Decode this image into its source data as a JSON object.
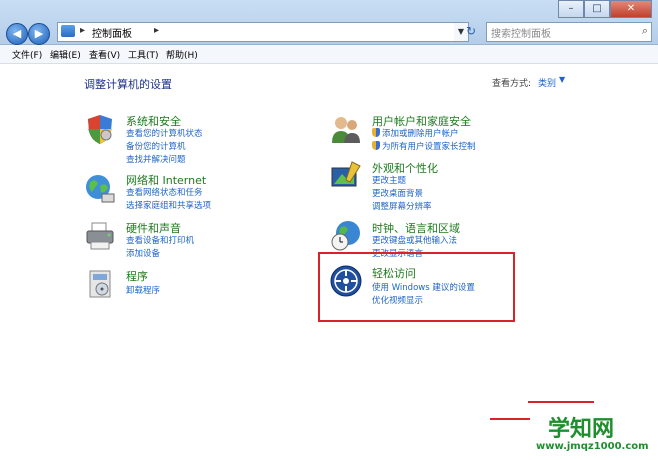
{
  "address": {
    "path": "控制面板",
    "separator": "▸"
  },
  "search": {
    "placeholder": "搜索控制面板"
  },
  "menu": [
    "文件(F)",
    "编辑(E)",
    "查看(V)",
    "工具(T)",
    "帮助(H)"
  ],
  "page_title": "调整计算机的设置",
  "view_by": {
    "label": "查看方式:",
    "value": "类别"
  },
  "categories": [
    {
      "title": "系统和安全",
      "links": [
        "查看您的计算机状态",
        "备份您的计算机",
        "查找并解决问题"
      ]
    },
    {
      "title": "网络和 Internet",
      "links": [
        "查看网络状态和任务",
        "选择家庭组和共享选项"
      ]
    },
    {
      "title": "硬件和声音",
      "links": [
        "查看设备和打印机",
        "添加设备"
      ]
    },
    {
      "title": "程序",
      "links": [
        "卸载程序"
      ]
    },
    {
      "title": "用户帐户和家庭安全",
      "links": [
        "添加或删除用户帐户",
        "为所有用户设置家长控制"
      ]
    },
    {
      "title": "外观和个性化",
      "links": [
        "更改主题",
        "更改桌面背景",
        "调整屏幕分辨率"
      ]
    },
    {
      "title": "时钟、语言和区域",
      "links": [
        "更改键盘或其他输入法",
        "更改显示语言"
      ]
    },
    {
      "title": "轻松访问",
      "links": [
        "使用 Windows 建议的设置",
        "优化视频显示"
      ]
    }
  ],
  "watermark": {
    "logo": "学知网",
    "url": "www.jmqz1000.com"
  },
  "colors": {
    "accent_link": "#1e64c8",
    "category_title": "#1e7a1e",
    "highlight": "#d8232a"
  }
}
